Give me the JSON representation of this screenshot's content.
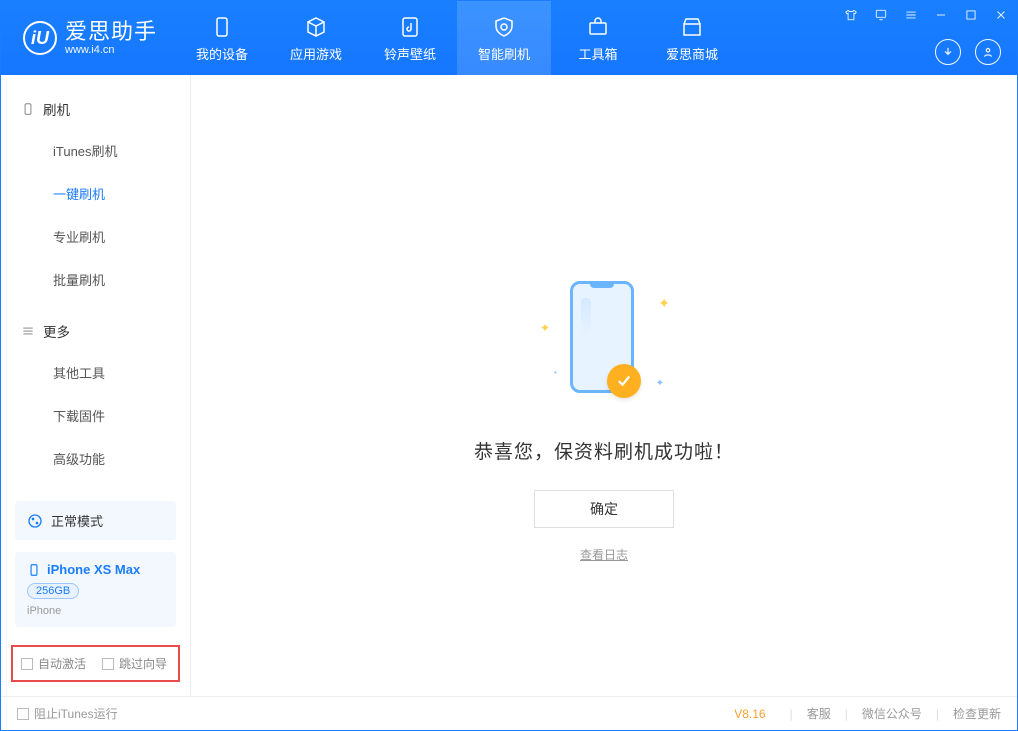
{
  "app": {
    "name": "爱思助手",
    "site": "www.i4.cn",
    "logo_letter": "iU"
  },
  "nav": {
    "items": [
      {
        "label": "我的设备"
      },
      {
        "label": "应用游戏"
      },
      {
        "label": "铃声壁纸"
      },
      {
        "label": "智能刷机",
        "active": true
      },
      {
        "label": "工具箱"
      },
      {
        "label": "爱思商城"
      }
    ]
  },
  "sidebar": {
    "sections": [
      {
        "title": "刷机",
        "icon": "phone-icon",
        "items": [
          {
            "label": "iTunes刷机"
          },
          {
            "label": "一键刷机",
            "active": true
          },
          {
            "label": "专业刷机"
          },
          {
            "label": "批量刷机"
          }
        ]
      },
      {
        "title": "更多",
        "icon": "menu-icon",
        "items": [
          {
            "label": "其他工具"
          },
          {
            "label": "下载固件"
          },
          {
            "label": "高级功能"
          }
        ]
      }
    ],
    "mode": {
      "label": "正常模式"
    },
    "device": {
      "name": "iPhone XS Max",
      "capacity": "256GB",
      "type": "iPhone"
    },
    "options": {
      "auto_activate": "自动激活",
      "skip_guide": "跳过向导"
    }
  },
  "main": {
    "success_message": "恭喜您，保资料刷机成功啦！",
    "ok_button": "确定",
    "view_log": "查看日志"
  },
  "status": {
    "block_itunes": "阻止iTunes运行",
    "version": "V8.16",
    "support": "客服",
    "wechat": "微信公众号",
    "update": "检查更新"
  }
}
